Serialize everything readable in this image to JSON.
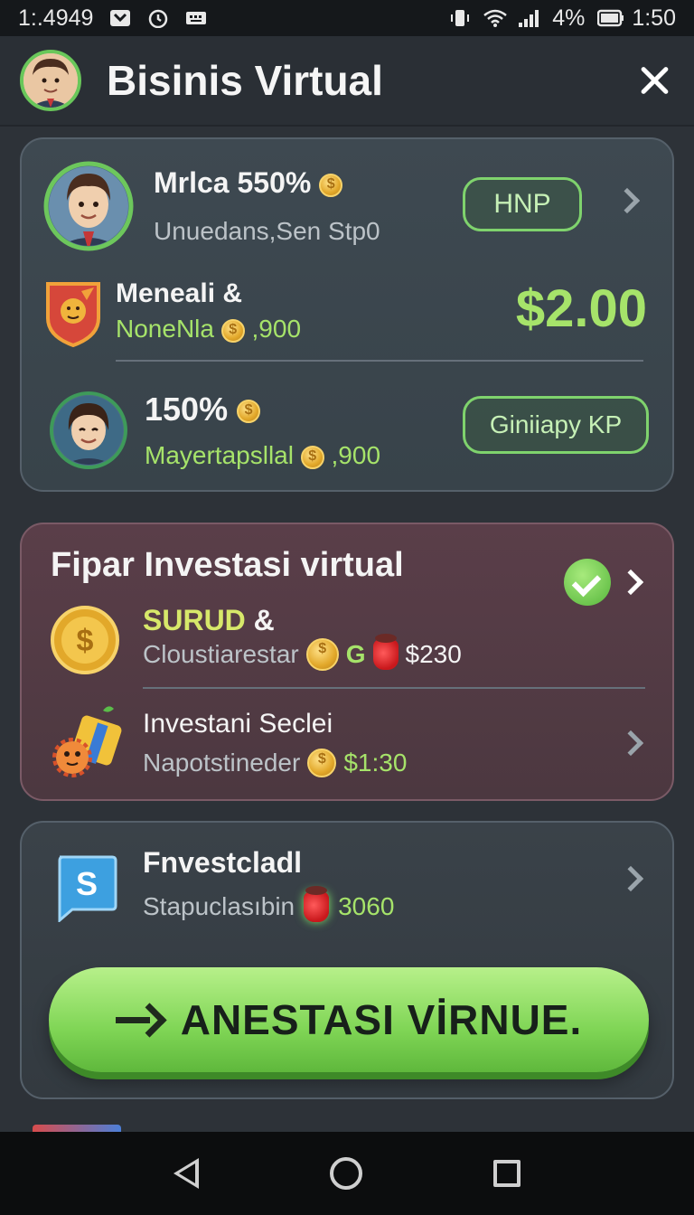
{
  "status_bar": {
    "left_text": "1:.4949",
    "battery": "4%",
    "time": "1:50"
  },
  "app_bar": {
    "title": "Bisinis Virtual"
  },
  "card1": {
    "row1": {
      "title": "Mrlca 550%",
      "subtitle": "Unuedans,Sen Stp0",
      "button_label": "HNP"
    },
    "row2": {
      "title": "Meneali &",
      "subtitle": "NoneNla",
      "coins": ",900",
      "amount": "$2.00"
    },
    "row3": {
      "title": "150%",
      "subtitle": "Mayertapsllal",
      "coins": ",900",
      "button_label": "Giniiapy KP"
    }
  },
  "card2": {
    "title": "Fipar Investasi virtual",
    "item1": {
      "title_green": "SURUD",
      "title_suffix": "&",
      "subtitle": "Cloustiarestar",
      "letter": "G",
      "amount": "$230"
    },
    "item2": {
      "title": "Investani Seclei",
      "subtitle": "Napotstineder",
      "amount": "$1:30"
    }
  },
  "card3": {
    "item": {
      "icon_letter": "S",
      "title": "Fnvestcladl",
      "subtitle": "Stapuclasıbin",
      "amount": "3060"
    },
    "cta_label": "ANESTASI VİRNUE."
  },
  "colors": {
    "accent_green": "#7fd555",
    "background": "#2d3238",
    "card_purple": "#5a3e49"
  }
}
